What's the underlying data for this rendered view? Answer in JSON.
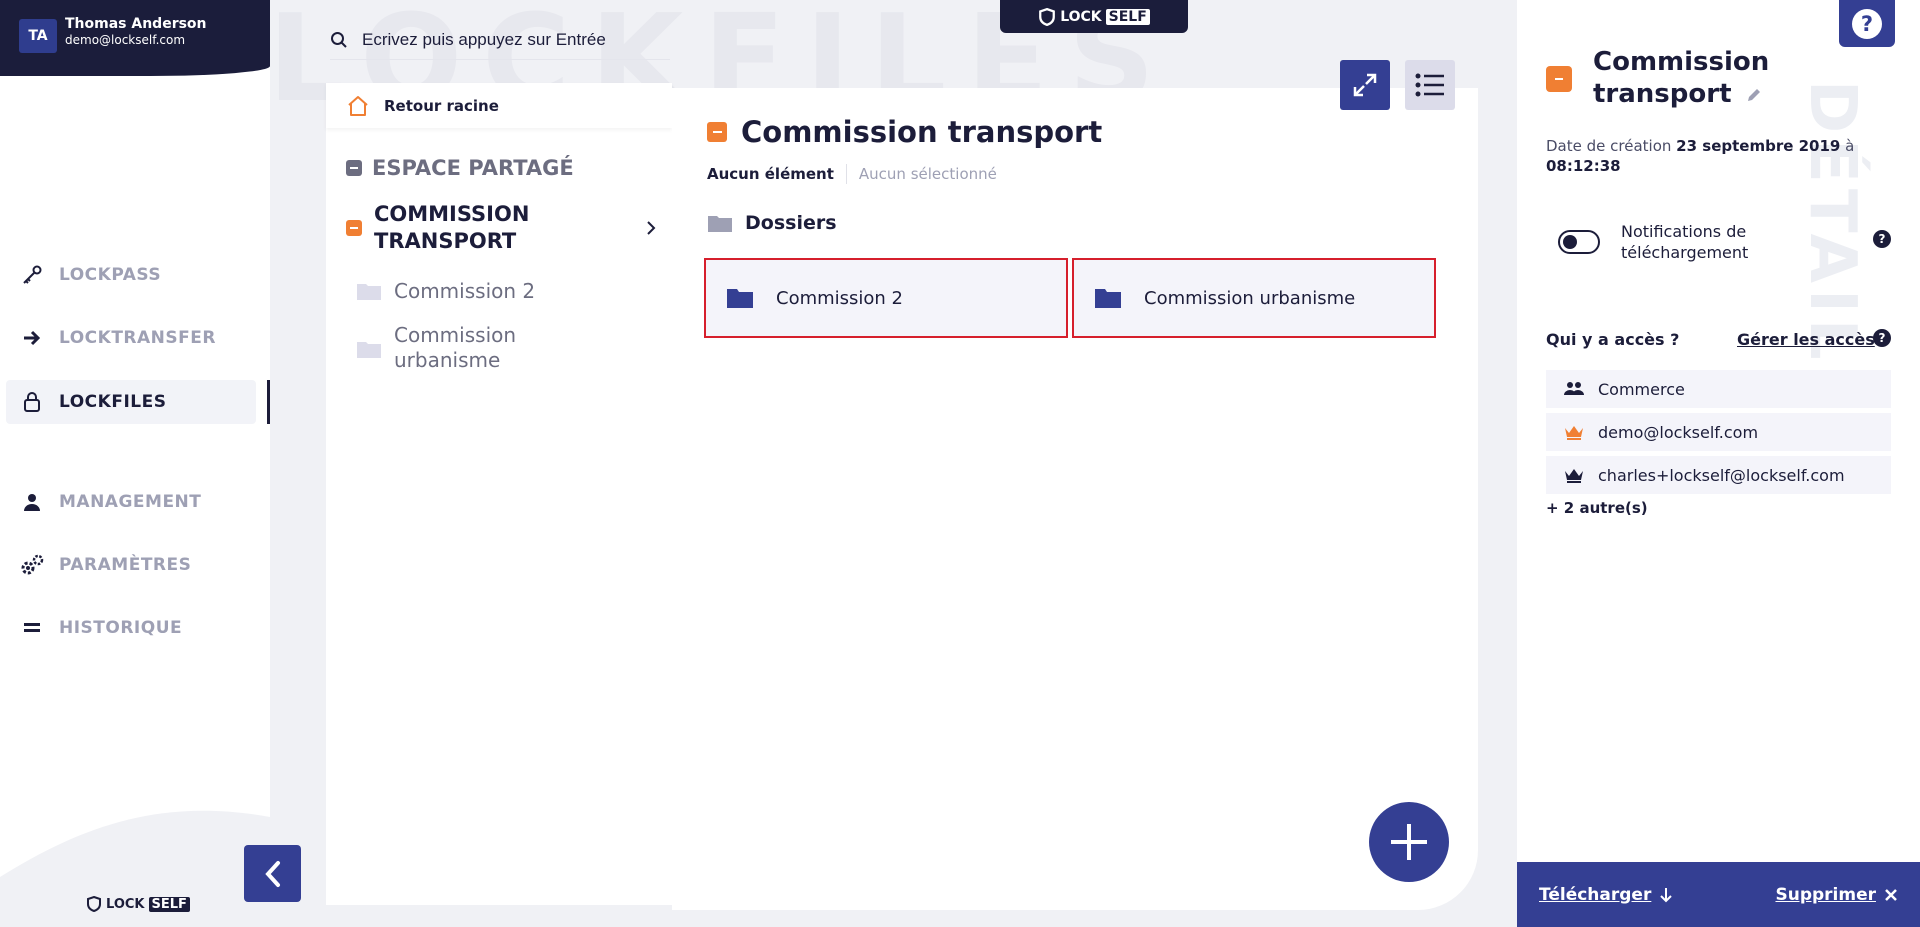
{
  "user": {
    "initials": "TA",
    "name": "Thomas Anderson",
    "email": "demo@lockself.com"
  },
  "nav": {
    "lockpass": "LOCKPASS",
    "locktransfer": "LOCKTRANSFER",
    "lockfiles": "LOCKFILES",
    "management": "MANAGEMENT",
    "parametres": "PARAMÈTRES",
    "historique": "HISTORIQUE"
  },
  "brand": {
    "lock": "LOCK",
    "self": "SELF"
  },
  "watermark": "LOCKFILES",
  "search": {
    "placeholder": "Ecrivez puis appuyez sur Entrée"
  },
  "tree": {
    "root": "Retour racine",
    "shared": "ESPACE PARTAGÉ",
    "current_line1": "COMMISSION",
    "current_line2": "TRANSPORT",
    "children": [
      {
        "label": "Commission 2"
      },
      {
        "label_line1": "Commission",
        "label_line2": "urbanisme"
      }
    ]
  },
  "main": {
    "title": "Commission transport",
    "count": "Aucun élément",
    "selected": "Aucun sélectionné",
    "folders_heading": "Dossiers",
    "folders": [
      {
        "label": "Commission 2"
      },
      {
        "label": "Commission urbanisme"
      }
    ]
  },
  "details": {
    "watermark": "DÉTAILS",
    "title_line1": "Commission",
    "title_line2": "transport",
    "created_label": "Date de création",
    "created_date": "23 septembre 2019",
    "created_at": "à",
    "created_time": "08:12:38",
    "notifications_line1": "Notifications de",
    "notifications_line2": "téléchargement",
    "access_heading": "Qui y a accès ?",
    "manage_access": "Gérer les accès",
    "access": [
      {
        "label": "Commerce",
        "icon": "group-icon"
      },
      {
        "label": "demo@lockself.com",
        "icon": "crown-icon",
        "color": "#f07f33"
      },
      {
        "label": "charles+lockself@lockself.com",
        "icon": "crown-icon",
        "color": "#1c1d3a"
      }
    ],
    "more": "+ 2 autre(s)",
    "download": "Télécharger",
    "delete": "Supprimer"
  },
  "colors": {
    "primary": "#343f93",
    "dark": "#1b1d3b",
    "orange": "#f07f33",
    "highlight": "#d61f2c"
  }
}
